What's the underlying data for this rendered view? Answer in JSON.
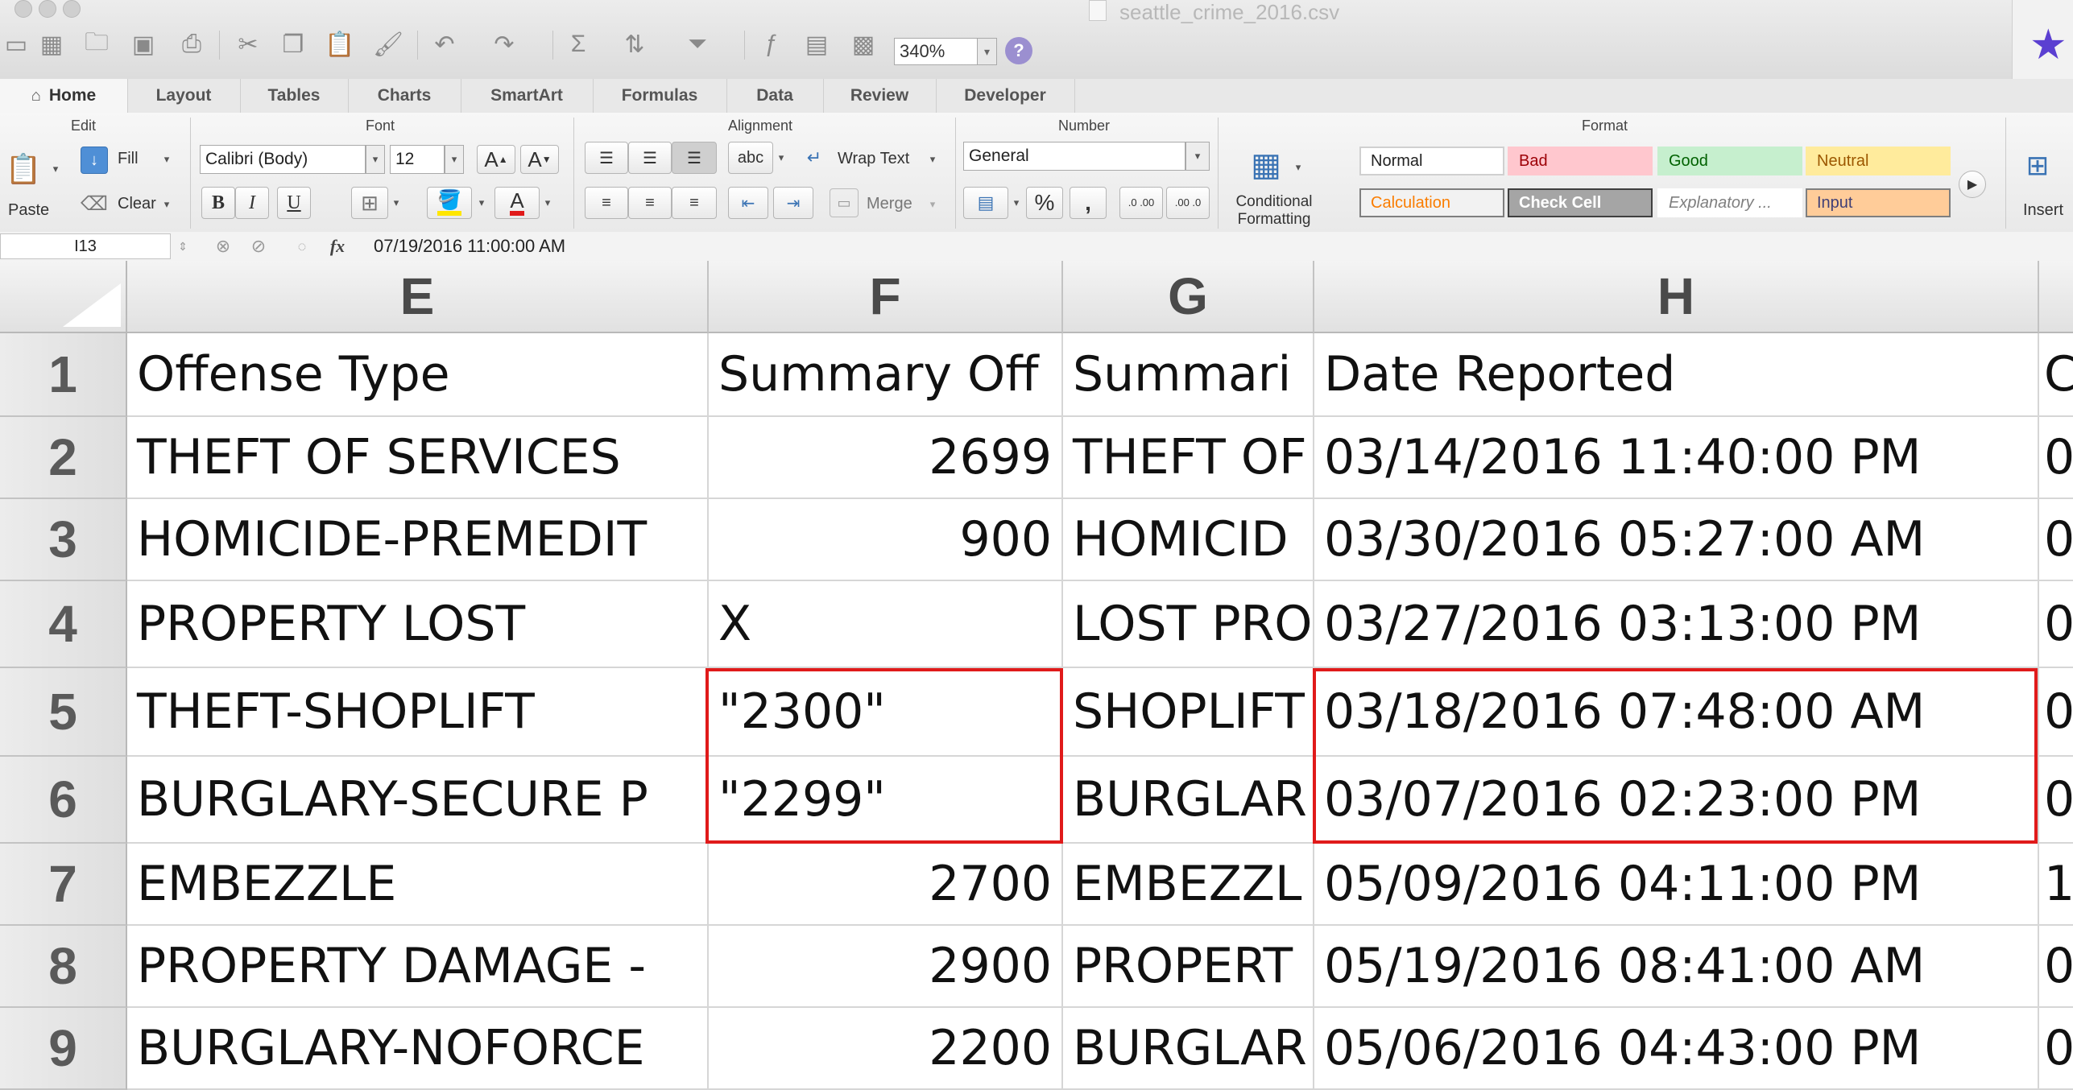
{
  "window": {
    "title": "seattle_crime_2016.csv",
    "zoom": "340%"
  },
  "ribbon": {
    "tabs": [
      "Home",
      "Layout",
      "Tables",
      "Charts",
      "SmartArt",
      "Formulas",
      "Data",
      "Review",
      "Developer"
    ],
    "active_tab": "Home",
    "groups": {
      "edit": {
        "label": "Edit",
        "paste": "Paste",
        "fill": "Fill",
        "clear": "Clear"
      },
      "font": {
        "label": "Font",
        "font_name": "Calibri (Body)",
        "font_size": "12",
        "bold": "B",
        "italic": "I",
        "underline": "U"
      },
      "alignment": {
        "label": "Alignment",
        "wrap_text": "Wrap Text",
        "merge": "Merge",
        "abc": "abc"
      },
      "number": {
        "label": "Number",
        "format": "General",
        "percent": "%",
        "comma": ",",
        "inc_decimal": ".0 .00",
        "dec_decimal": ".00 .0"
      },
      "format": {
        "label": "Format",
        "conditional_formatting": [
          "Conditional",
          "Formatting"
        ],
        "styles": [
          {
            "name": "Normal",
            "bg": "#ffffff",
            "color": "#222222",
            "border": "#d0d0d0"
          },
          {
            "name": "Bad",
            "bg": "#ffc7ce",
            "color": "#9c0006",
            "border": "#ffc7ce"
          },
          {
            "name": "Good",
            "bg": "#c6efce",
            "color": "#006100",
            "border": "#c6efce"
          },
          {
            "name": "Neutral",
            "bg": "#ffeb9c",
            "color": "#9c5700",
            "border": "#ffeb9c"
          },
          {
            "name": "Calculation",
            "bg": "#f2f2f2",
            "color": "#fa7d00",
            "border": "#7f7f7f"
          },
          {
            "name": "Check Cell",
            "bg": "#a5a5a5",
            "color": "#ffffff",
            "border": "#3f3f3f"
          },
          {
            "name": "Explanatory ...",
            "bg": "#ffffff",
            "color": "#7f7f7f",
            "border": "#ffffff"
          },
          {
            "name": "Input",
            "bg": "#ffcc99",
            "color": "#3f3f76",
            "border": "#7f7f7f"
          }
        ]
      },
      "cells": {
        "insert": "Insert"
      }
    }
  },
  "formula_bar": {
    "name_box": "I13",
    "fx": "fx",
    "value": "07/19/2016 11:00:00 AM"
  },
  "sheet": {
    "columns": [
      "E",
      "F",
      "G",
      "H"
    ],
    "rows": [
      {
        "num": "1",
        "E": "Offense Type",
        "F": "Summary Off",
        "G": "Summari",
        "H": "Date Reported",
        "I": "C"
      },
      {
        "num": "2",
        "E": "THEFT OF SERVICES",
        "F": "2699",
        "G": "THEFT OF",
        "H": "03/14/2016 11:40:00 PM",
        "I": "0"
      },
      {
        "num": "3",
        "E": "HOMICIDE-PREMEDIT",
        "F": "900",
        "G": "HOMICID",
        "H": "03/30/2016 05:27:00 AM",
        "I": "0"
      },
      {
        "num": "4",
        "E": "PROPERTY LOST",
        "F": "X",
        "G": "LOST PRO",
        "H": "03/27/2016 03:13:00 PM",
        "I": "0"
      },
      {
        "num": "5",
        "E": "THEFT-SHOPLIFT",
        "F": "\"2300\"",
        "G": "SHOPLIFT",
        "H": "03/18/2016 07:48:00 AM",
        "I": "0"
      },
      {
        "num": "6",
        "E": "BURGLARY-SECURE P",
        "F": "\"2299\"",
        "G": "BURGLAR",
        "H": "03/07/2016 02:23:00 PM",
        "I": "0"
      },
      {
        "num": "7",
        "E": "EMBEZZLE",
        "F": "2700",
        "G": "EMBEZZL",
        "H": "05/09/2016 04:11:00 PM",
        "I": "1"
      },
      {
        "num": "8",
        "E": "PROPERTY DAMAGE -",
        "F": "2900",
        "G": "PROPERT",
        "H": "05/19/2016 08:41:00 AM",
        "I": "0"
      },
      {
        "num": "9",
        "E": "BURGLARY-NOFORCE",
        "F": "2200",
        "G": "BURGLAR",
        "H": "05/06/2016 04:43:00 PM",
        "I": "0"
      }
    ]
  },
  "colors": {
    "highlight": "#e01a1a",
    "font_color_bar": "#e01a1a",
    "fill_color_bar": "#ffe600"
  }
}
